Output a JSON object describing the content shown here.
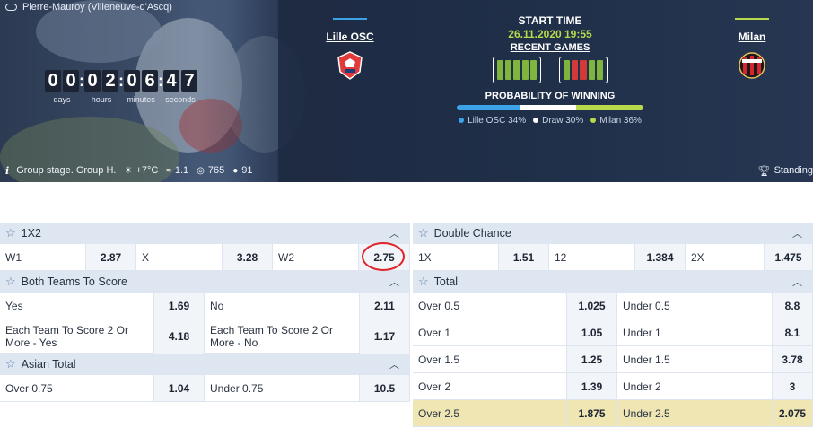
{
  "hero": {
    "venue": "Pierre-Mauroy (Villeneuve-d'Ascq)",
    "countdown": {
      "days": [
        "0",
        "0"
      ],
      "hours": [
        "0",
        "2"
      ],
      "minutes": [
        "0",
        "6"
      ],
      "seconds": [
        "4",
        "7"
      ],
      "labels": {
        "days": "days",
        "hours": "hours",
        "minutes": "minutes",
        "seconds": "seconds"
      }
    },
    "info": {
      "stage": "Group stage. Group H.",
      "temp": "+7°C",
      "wind": "1.1",
      "pressure": "765",
      "humidity": "91",
      "standings": "Standing"
    },
    "home": {
      "name": "Lille OSC",
      "bar_color": "#3ca3e8"
    },
    "away": {
      "name": "Milan",
      "bar_color": "#b7d94a"
    },
    "center": {
      "start_title": "START TIME",
      "start_date": "26.11.2020 19:55",
      "recent_games": "RECENT GAMES",
      "prob_title": "PROBABILITY OF WINNING",
      "home_form": [
        "W",
        "W",
        "W",
        "W",
        "W"
      ],
      "away_form": [
        "W",
        "L",
        "L",
        "W",
        "W"
      ],
      "prob": {
        "home": 34,
        "draw": 30,
        "away": 36
      },
      "legend": {
        "home": "Lille OSC 34%",
        "draw": "Draw 30%",
        "away": "Milan 36%"
      }
    },
    "colors": {
      "home": "#3ca3e8",
      "draw": "#ffffff",
      "away": "#b7d94a",
      "form_win": "#7fb53c",
      "form_loss": "#d23a3a"
    }
  },
  "markets": {
    "x12": {
      "title": "1X2",
      "items": [
        {
          "name": "W1",
          "odd": "2.87"
        },
        {
          "name": "X",
          "odd": "3.28"
        },
        {
          "name": "W2",
          "odd": "2.75"
        }
      ]
    },
    "btts": {
      "title": "Both Teams To Score",
      "rows": [
        [
          {
            "name": "Yes",
            "odd": "1.69"
          },
          {
            "name": "No",
            "odd": "2.11"
          }
        ],
        [
          {
            "name": "Each Team To Score 2 Or More - Yes",
            "odd": "4.18"
          },
          {
            "name": "Each Team To Score 2 Or More - No",
            "odd": "1.17"
          }
        ]
      ]
    },
    "asian": {
      "title": "Asian Total",
      "rows": [
        [
          {
            "name": "Over 0.75",
            "odd": "1.04"
          },
          {
            "name": "Under 0.75",
            "odd": "10.5"
          }
        ]
      ]
    },
    "dc": {
      "title": "Double Chance",
      "items": [
        {
          "name": "1X",
          "odd": "1.51"
        },
        {
          "name": "12",
          "odd": "1.384"
        },
        {
          "name": "2X",
          "odd": "1.475"
        }
      ]
    },
    "total": {
      "title": "Total",
      "rows": [
        [
          {
            "name": "Over 0.5",
            "odd": "1.025"
          },
          {
            "name": "Under 0.5",
            "odd": "8.8"
          }
        ],
        [
          {
            "name": "Over 1",
            "odd": "1.05"
          },
          {
            "name": "Under 1",
            "odd": "8.1"
          }
        ],
        [
          {
            "name": "Over 1.5",
            "odd": "1.25"
          },
          {
            "name": "Under 1.5",
            "odd": "3.78"
          }
        ],
        [
          {
            "name": "Over 2",
            "odd": "1.39"
          },
          {
            "name": "Under 2",
            "odd": "3"
          }
        ],
        [
          {
            "name": "Over 2.5",
            "odd": "1.875"
          },
          {
            "name": "Under 2.5",
            "odd": "2.075"
          }
        ]
      ]
    }
  }
}
